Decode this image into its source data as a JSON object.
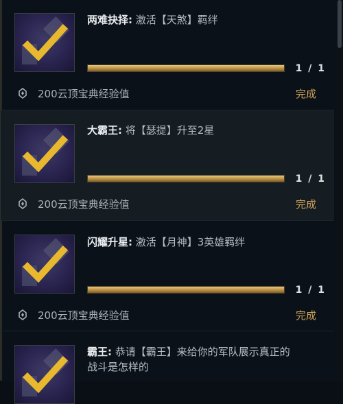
{
  "missions": [
    {
      "name": "两难抉择:",
      "desc": " 激活【天煞】羁绊",
      "progress": "1 / 1",
      "progress_fraction": 1.0,
      "reward": "200云顶宝典经验值",
      "status": "完成"
    },
    {
      "name": "大霸王:",
      "desc": " 将【瑟提】升至2星",
      "progress": "1 / 1",
      "progress_fraction": 1.0,
      "reward": "200云顶宝典经验值",
      "status": "完成"
    },
    {
      "name": "闪耀升星:",
      "desc": " 激活【月神】3英雄羁绊",
      "progress": "1 / 1",
      "progress_fraction": 1.0,
      "reward": "200云顶宝典经验值",
      "status": "完成"
    },
    {
      "name": "霸王:",
      "desc": " 恭请【霸王】来给你的军队展示真正的战斗是怎样的",
      "line1": " 恭请【霸王】来给你的军队展示真正的",
      "line2": "战斗是怎样的"
    }
  ],
  "colors": {
    "gold": "#cda45a",
    "background": "#0b1118",
    "alt_row": "#151c22",
    "check": "#e8b92f"
  },
  "icons": {
    "thumbnail": "checkmark-badge-icon",
    "reward": "xp-gem-icon"
  }
}
